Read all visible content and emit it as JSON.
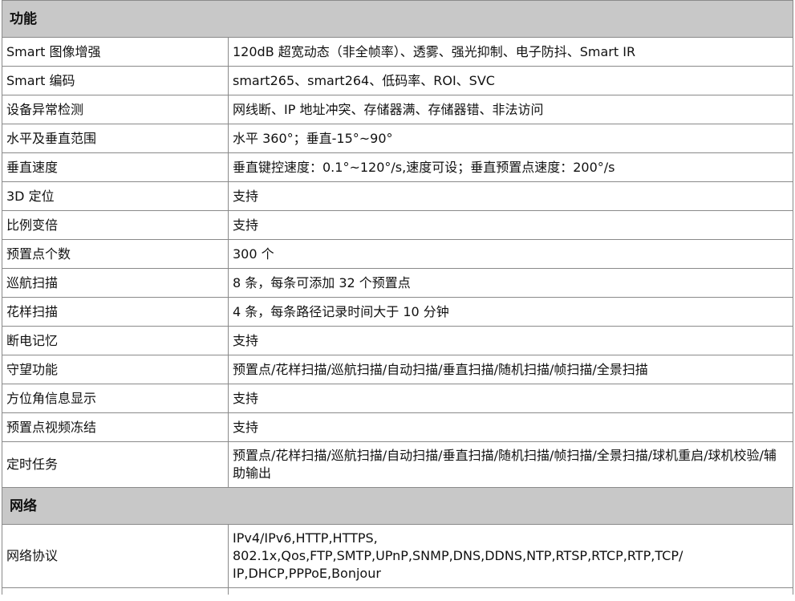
{
  "sections": [
    {
      "title": "功能",
      "rows": [
        {
          "label": "Smart 图像增强",
          "value": "120dB 超宽动态（非全帧率）、透雾、强光抑制、电子防抖、Smart IR"
        },
        {
          "label": "Smart 编码",
          "value": "smart265、smart264、低码率、ROI、SVC"
        },
        {
          "label": "设备异常检测",
          "value": "网线断、IP 地址冲突、存储器满、存储器错、非法访问"
        },
        {
          "label": "水平及垂直范围",
          "value": "水平 360°；垂直-15°~90°"
        },
        {
          "label": "垂直速度",
          "value": "垂直键控速度：0.1°~120°/s,速度可设；垂直预置点速度：200°/s"
        },
        {
          "label": "3D 定位",
          "value": "支持"
        },
        {
          "label": "比例变倍",
          "value": "支持"
        },
        {
          "label": "预置点个数",
          "value": "300 个"
        },
        {
          "label": "巡航扫描",
          "value": "8 条，每条可添加 32 个预置点"
        },
        {
          "label": "花样扫描",
          "value": "4 条，每条路径记录时间大于 10 分钟"
        },
        {
          "label": "断电记忆",
          "value": "支持"
        },
        {
          "label": "守望功能",
          "value": "预置点/花样扫描/巡航扫描/自动扫描/垂直扫描/随机扫描/帧扫描/全景扫描"
        },
        {
          "label": "方位角信息显示",
          "value": "支持"
        },
        {
          "label": "预置点视频冻结",
          "value": "支持"
        },
        {
          "label": "定时任务",
          "value": "预置点/花样扫描/巡航扫描/自动扫描/垂直扫描/随机扫描/帧扫描/全景扫描/球机重启/球机校验/辅助输出"
        }
      ]
    },
    {
      "title": "网络",
      "rows": [
        {
          "label": "网络协议",
          "value": "IPv4/IPv6,HTTP,HTTPS,\n802.1x,Qos,FTP,SMTP,UPnP,SNMP,DNS,DDNS,NTP,RTSP,RTCP,RTP,TCP/\nIP,DHCP,PPPoE,Bonjour"
        }
      ]
    }
  ]
}
